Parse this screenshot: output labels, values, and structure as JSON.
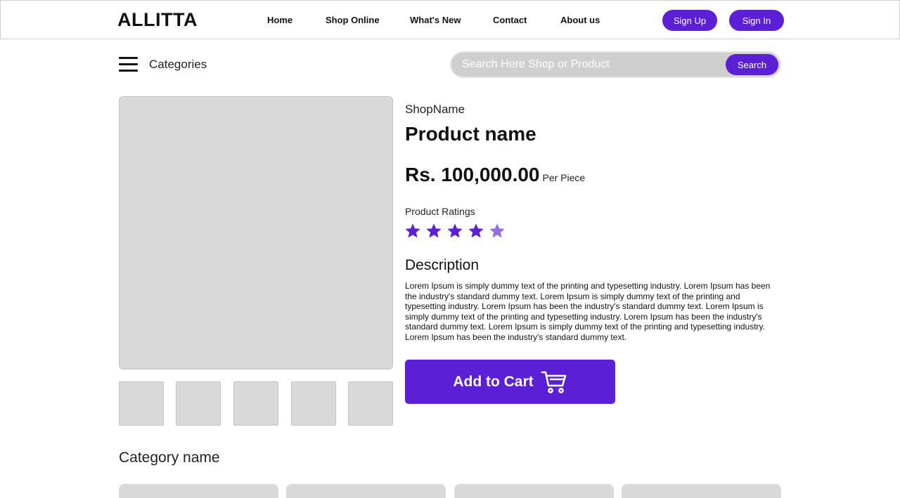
{
  "brand": {
    "logo": "ALLITTA",
    "accent_color": "#5b1fd6"
  },
  "nav": {
    "links": [
      "Home",
      "Shop Online",
      "What's New",
      "Contact",
      "About us"
    ],
    "sign_up": "Sign Up",
    "sign_in": "Sign In"
  },
  "toolbar": {
    "menu_icon": "hamburger-icon",
    "categories_label": "Categories",
    "search_placeholder": "Search Here Shop or Product",
    "search_button": "Search"
  },
  "product": {
    "shop_name": "ShopName",
    "name": "Product name",
    "price": "Rs. 100,000.00",
    "price_unit": "Per Piece",
    "ratings_label": "Product Ratings",
    "rating": 4.5,
    "rating_max": 5,
    "description_title": "Description",
    "description": "Lorem Ipsum is simply dummy text of the printing and typesetting industry. Lorem Ipsum has been the industry's standard dummy text. Lorem Ipsum is simply dummy text of the printing and typesetting industry. Lorem Ipsum has been the industry's standard dummy text. Lorem Ipsum is simply dummy text of the printing and typesetting industry. Lorem Ipsum has been the industry's standard dummy text. Lorem Ipsum is simply dummy text of the printing and typesetting industry. Lorem Ipsum has been the industry's standard dummy text.",
    "add_to_cart": "Add to Cart",
    "cart_icon": "cart-icon"
  },
  "related": {
    "category_name": "Category name"
  }
}
